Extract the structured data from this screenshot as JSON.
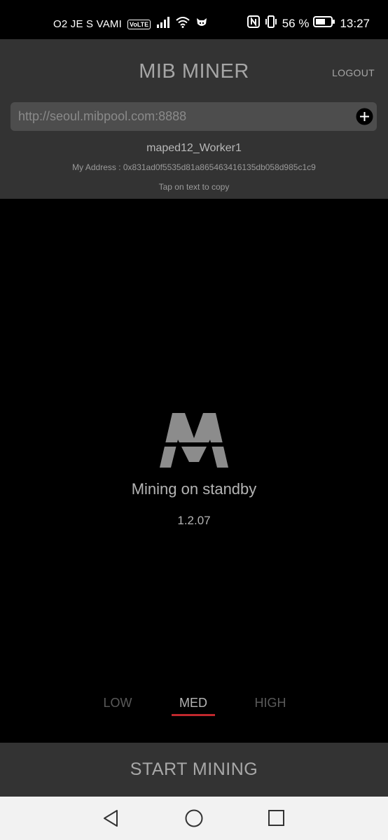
{
  "status_bar": {
    "carrier": "O2 JE S VAMI",
    "volte": "VoLTE",
    "battery_percent": "56 %",
    "time": "13:27",
    "icons": [
      "signal-icon",
      "wifi-icon",
      "cat-icon",
      "nfc-icon",
      "vibrate-icon",
      "battery-icon"
    ]
  },
  "header": {
    "title": "MIB MINER",
    "logout_label": "LOGOUT",
    "pool_url": "http://seoul.mibpool.com:8888",
    "worker_name": "maped12_Worker1",
    "address_text": "My Address : 0x831ad0f5535d81a865463416135db058d985c1c9",
    "copy_hint": "Tap on text to copy"
  },
  "main": {
    "status": "Mining on standby",
    "version": "1.2.07"
  },
  "intensity": {
    "options": [
      "LOW",
      "MED",
      "HIGH"
    ],
    "selected": "MED"
  },
  "action": {
    "start_label": "START MINING"
  },
  "colors": {
    "header_bg": "#333333",
    "accent": "#c0282d",
    "background": "#000000"
  }
}
